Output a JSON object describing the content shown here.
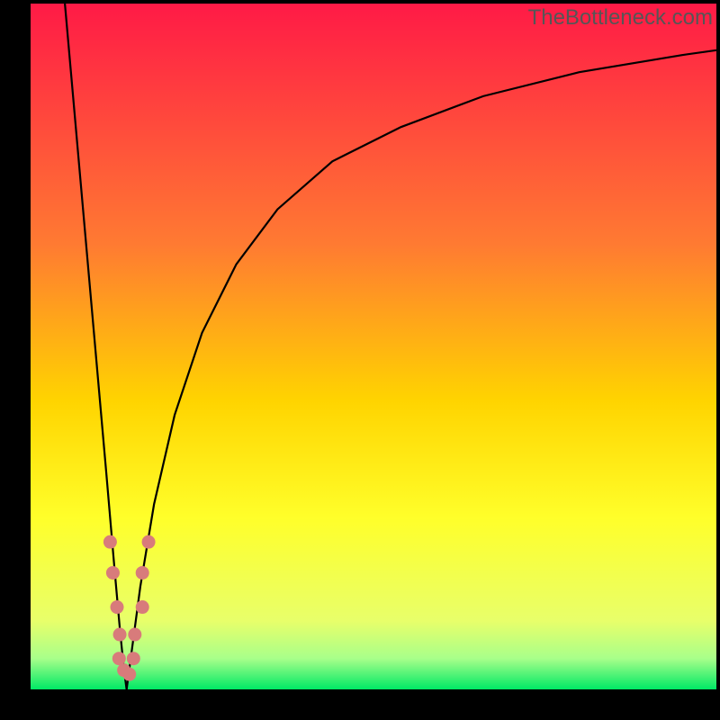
{
  "watermark": "TheBottleneck.com",
  "colors": {
    "gradient_top": "#ff1a46",
    "gradient_mid1": "#ff7a32",
    "gradient_mid2": "#ffd400",
    "gradient_mid3": "#ffff2a",
    "gradient_bottom": "#00e865",
    "curve": "#000000",
    "dots": "#d87b7b",
    "frame": "#000000"
  },
  "chart_data": {
    "type": "line",
    "title": "",
    "xlabel": "",
    "ylabel": "",
    "xlim": [
      0,
      100
    ],
    "ylim": [
      0,
      100
    ],
    "series": [
      {
        "name": "left-branch",
        "x": [
          5.0,
          6.5,
          8.0,
          9.5,
          11.0,
          12.2,
          13.0,
          13.6,
          14.0
        ],
        "y": [
          100,
          83,
          66,
          49,
          32,
          18,
          9,
          3,
          0
        ]
      },
      {
        "name": "right-branch",
        "x": [
          14.0,
          14.8,
          16.0,
          18.0,
          21.0,
          25.0,
          30.0,
          36.0,
          44.0,
          54.0,
          66.0,
          80.0,
          95.0,
          100.0
        ],
        "y": [
          0,
          6,
          15,
          27,
          40,
          52,
          62,
          70,
          77,
          82,
          86.5,
          90,
          92.5,
          93.2
        ]
      }
    ],
    "scatter": {
      "name": "dots",
      "points": [
        {
          "x": 11.6,
          "y": 21.5
        },
        {
          "x": 12.0,
          "y": 17.0
        },
        {
          "x": 12.6,
          "y": 12.0
        },
        {
          "x": 13.0,
          "y": 8.0
        },
        {
          "x": 12.9,
          "y": 4.5
        },
        {
          "x": 13.6,
          "y": 2.8
        },
        {
          "x": 14.4,
          "y": 2.2
        },
        {
          "x": 15.0,
          "y": 4.5
        },
        {
          "x": 15.2,
          "y": 8.0
        },
        {
          "x": 16.3,
          "y": 12.0
        },
        {
          "x": 16.3,
          "y": 17.0
        },
        {
          "x": 17.2,
          "y": 21.5
        }
      ]
    },
    "background_gradient_stops": [
      {
        "offset": 0.0,
        "color": "#ff1a46"
      },
      {
        "offset": 0.35,
        "color": "#ff7a32"
      },
      {
        "offset": 0.58,
        "color": "#ffd400"
      },
      {
        "offset": 0.75,
        "color": "#ffff2a"
      },
      {
        "offset": 0.9,
        "color": "#e8ff6a"
      },
      {
        "offset": 0.955,
        "color": "#a8ff8a"
      },
      {
        "offset": 1.0,
        "color": "#00e865"
      }
    ]
  }
}
